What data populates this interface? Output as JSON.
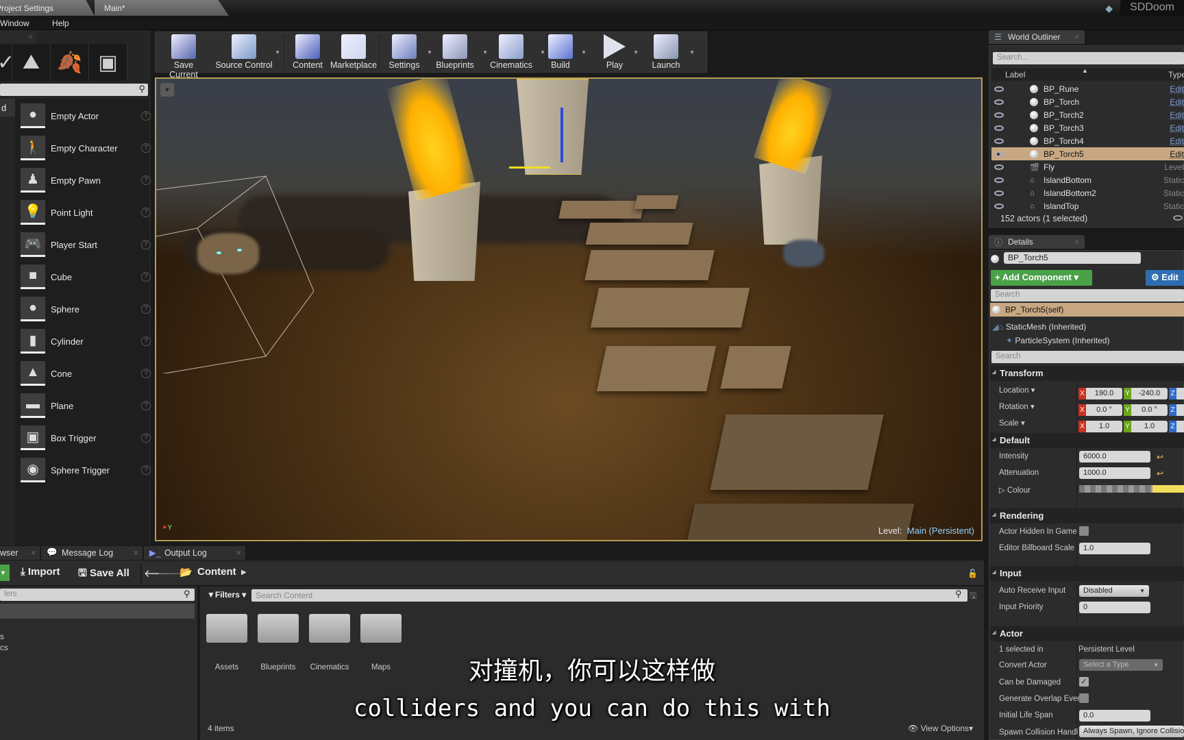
{
  "titlebar": {
    "tabs": [
      "Project Settings",
      "Main*"
    ],
    "project_name": "SDDoom"
  },
  "menubar": [
    "Window",
    "Help"
  ],
  "modes": {
    "place_items": [
      "Empty Actor",
      "Empty Character",
      "Empty Pawn",
      "Point Light",
      "Player Start",
      "Cube",
      "Sphere",
      "Cylinder",
      "Cone",
      "Plane",
      "Box Trigger",
      "Sphere Trigger"
    ],
    "category_label": "d"
  },
  "toolbar": {
    "buttons": [
      "Save Current",
      "Source Control",
      "Content",
      "Marketplace",
      "Settings",
      "Blueprints",
      "Cinematics",
      "Build",
      "Play",
      "Launch"
    ]
  },
  "viewport": {
    "level_label": "Level:",
    "level_name": "Main (Persistent)"
  },
  "outliner": {
    "tab": "World Outliner",
    "search_placeholder": "Search...",
    "col_label": "Label",
    "col_type": "Type",
    "rows": [
      {
        "name": "BP_Rune",
        "type": "Edit"
      },
      {
        "name": "BP_Torch",
        "type": "Edit"
      },
      {
        "name": "BP_Torch2",
        "type": "Edit"
      },
      {
        "name": "BP_Torch3",
        "type": "Edit"
      },
      {
        "name": "BP_Torch4",
        "type": "Edit"
      },
      {
        "name": "BP_Torch5",
        "type": "Edit"
      },
      {
        "name": "Fly",
        "type": "Level"
      },
      {
        "name": "IslandBottom",
        "type": "Static"
      },
      {
        "name": "IslandBottom2",
        "type": "Static"
      },
      {
        "name": "IslandTop",
        "type": "Static"
      }
    ],
    "selected": "BP_Torch5",
    "footer": "152 actors (1 selected)"
  },
  "details": {
    "tab": "Details",
    "actor_name": "BP_Torch5",
    "add_component": "+ Add Component",
    "edit_bp": "Edit",
    "search_placeholder": "Search",
    "components": [
      "BP_Torch5(self)",
      "StaticMesh (Inherited)",
      "ParticleSystem (Inherited)"
    ],
    "search2_placeholder": "Search",
    "transform": {
      "title": "Transform",
      "location_label": "Location",
      "location": [
        "190.0",
        "-240.0"
      ],
      "rotation_label": "Rotation",
      "rotation": [
        "0.0 °",
        "0.0 °"
      ],
      "scale_label": "Scale",
      "scale": [
        "1.0",
        "1.0"
      ]
    },
    "default": {
      "title": "Default",
      "intensity_label": "Intensity",
      "intensity": "6000.0",
      "attenuation_label": "Attenuation",
      "attenuation": "1000.0",
      "colour_label": "Colour",
      "colour": "#f2dc5c"
    },
    "rendering": {
      "title": "Rendering",
      "hidden_label": "Actor Hidden In Game",
      "hidden": false,
      "billboard_label": "Editor Billboard Scale",
      "billboard": "1.0"
    },
    "input": {
      "title": "Input",
      "auto_label": "Auto Receive Input",
      "auto": "Disabled",
      "priority_label": "Input Priority",
      "priority": "0"
    },
    "actor": {
      "title": "Actor",
      "selected_label": "1 selected in",
      "selected_value": "Persistent Level",
      "convert_label": "Convert Actor",
      "convert_value": "Select a Type",
      "damaged_label": "Can be Damaged",
      "damaged": true,
      "overlap_label": "Generate Overlap Even",
      "overlap": false,
      "lifespan_label": "Initial Life Span",
      "lifespan": "0.0",
      "spawn_label": "Spawn Collision Handl",
      "spawn_value": "Always Spawn, Ignore Collisio"
    }
  },
  "content_browser": {
    "tabs": [
      "wser",
      "Message Log",
      "Output Log"
    ],
    "import": "Import",
    "save_all": "Save All",
    "path": "Content",
    "filter_placeholder": "lers",
    "filters": "Filters",
    "search_placeholder": "Search Content",
    "folders": [
      "Assets",
      "Blueprints",
      "Cinematics",
      "Maps"
    ],
    "tree_items": [
      "s",
      "cs"
    ],
    "item_count": "4 items",
    "view_options": "View Options"
  },
  "subtitles": {
    "zh": "对撞机，你可以这样做",
    "en": "colliders and you can do this with"
  }
}
